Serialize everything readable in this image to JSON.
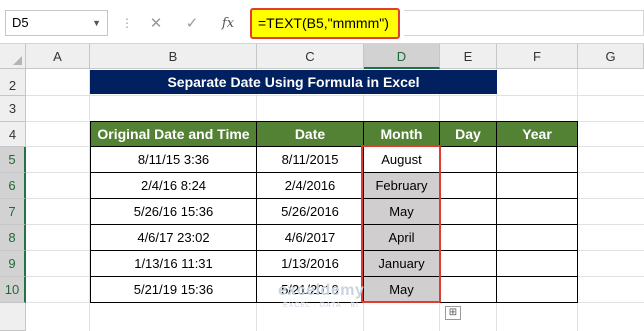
{
  "formula_bar": {
    "name_box": "D5",
    "formula": "=TEXT(B5,\"mmmm\")",
    "icons": [
      "cancel-icon",
      "enter-check-icon",
      "insert-function-icon"
    ]
  },
  "columns": [
    "A",
    "B",
    "C",
    "D",
    "E",
    "F",
    "G"
  ],
  "rows": [
    "2",
    "3",
    "4",
    "5",
    "6",
    "7",
    "8",
    "9",
    "10"
  ],
  "title": "Separate Date Using Formula in Excel",
  "table": {
    "headers": [
      "Original Date and Time",
      "Date",
      "Month",
      "Day",
      "Year"
    ],
    "rows": [
      {
        "original": "8/11/15 3:36",
        "date": "8/11/2015",
        "month": "August",
        "day": "",
        "year": ""
      },
      {
        "original": "2/4/16 8:24",
        "date": "2/4/2016",
        "month": "February",
        "day": "",
        "year": ""
      },
      {
        "original": "5/26/16 15:36",
        "date": "5/26/2016",
        "month": "May",
        "day": "",
        "year": ""
      },
      {
        "original": "4/6/17 23:02",
        "date": "4/6/2017",
        "month": "April",
        "day": "",
        "year": ""
      },
      {
        "original": "1/13/16 11:31",
        "date": "1/13/2016",
        "month": "January",
        "day": "",
        "year": ""
      },
      {
        "original": "5/21/19 15:36",
        "date": "5/21/2019",
        "month": "May",
        "day": "",
        "year": ""
      }
    ]
  },
  "watermark": {
    "name": "exceldemy",
    "tagline": "EXCEL · DATA · BI"
  },
  "colors": {
    "title_bg": "#002060",
    "header_bg": "#548235",
    "highlight": "#ffff00",
    "outline": "#e03c31",
    "selected_fill": "#d0cece"
  }
}
